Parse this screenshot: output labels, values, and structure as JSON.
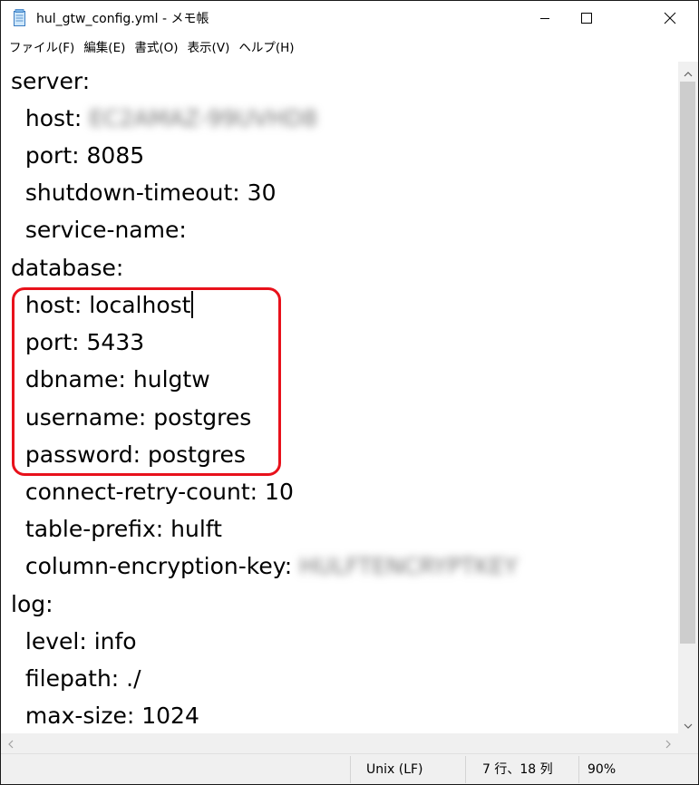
{
  "window": {
    "title": "hul_gtw_config.yml - メモ帳",
    "icon": "notepad-icon",
    "controls": [
      "minimize-icon",
      "maximize-icon",
      "close-icon"
    ]
  },
  "menu": {
    "file": "ファイル(F)",
    "edit": "編集(E)",
    "format": "書式(O)",
    "view": "表示(V)",
    "help": "ヘルプ(H)"
  },
  "editor": {
    "lines": [
      "server:",
      "  host: ",
      "  port: 8085",
      "  shutdown-timeout: 30",
      "  service-name:",
      "database:",
      "  host: localhost",
      "  port: 5433",
      "  dbname: hulgtw",
      "  username: postgres",
      "  password: postgres",
      "  connect-retry-count: 10",
      "  table-prefix: hulft",
      "  column-encryption-key: ",
      "log:",
      "  level: info",
      "  filepath: ./",
      "  max-size: 1024"
    ],
    "redacted": {
      "server_host": "EC2AMAZ-99UVHD8",
      "encryption_key": "HULFTENCRYPTKEY"
    },
    "highlight_color": "#e8111b"
  },
  "status": {
    "line_ending": "Unix (LF)",
    "position": "7 行、18 列",
    "zoom": "90%"
  }
}
